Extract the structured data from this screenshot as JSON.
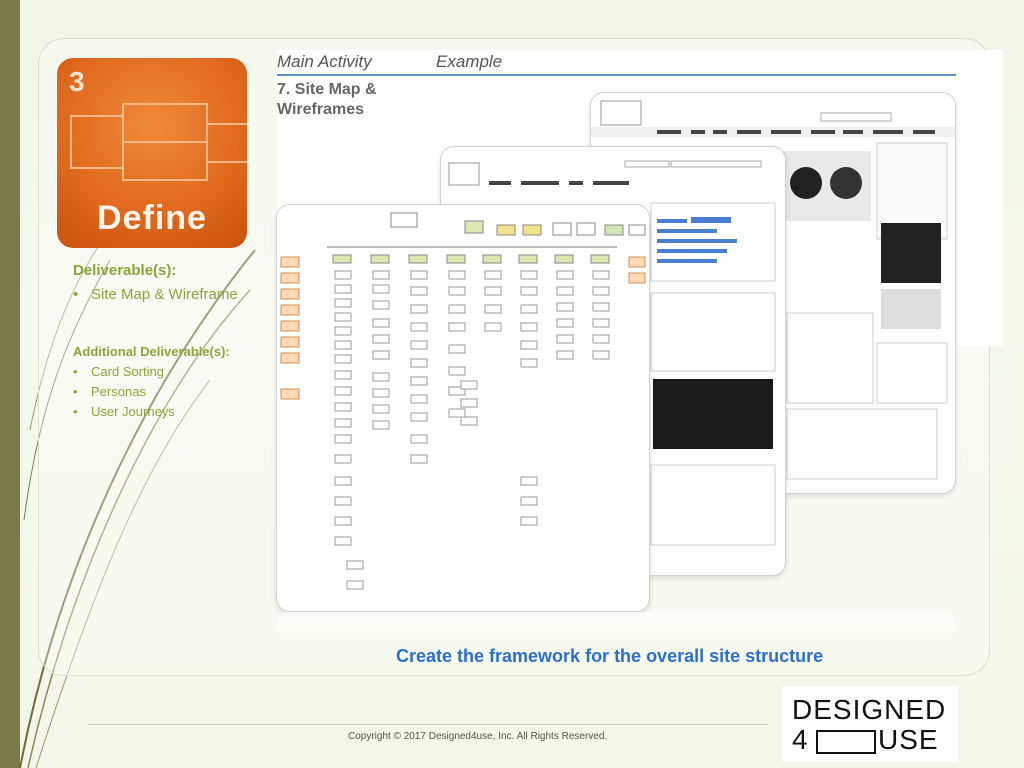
{
  "header": {
    "main_activity": "Main Activity",
    "example": "Example"
  },
  "step": {
    "title": "7. Site Map & Wireframes"
  },
  "define_tile": {
    "number": "3",
    "label": "Define"
  },
  "deliverables": {
    "heading": "Deliverable(s):",
    "items": [
      "Site Map & Wireframe"
    ]
  },
  "additional": {
    "heading": "Additional Deliverable(s):",
    "items": [
      "Card Sorting",
      "Personas",
      "User Journeys"
    ]
  },
  "caption": "Create the framework for the overall site structure",
  "footer": {
    "copyright": "Copyright © 2017 Designed4use, Inc. All Rights Reserved."
  },
  "logo": {
    "top": "DESIGNED",
    "four": "4",
    "use": "USE"
  },
  "colors": {
    "accent_blue": "#2b6fce",
    "green": "#8aa43a",
    "orange": "#e06a1e",
    "sidebar": "#7a7a4a"
  }
}
